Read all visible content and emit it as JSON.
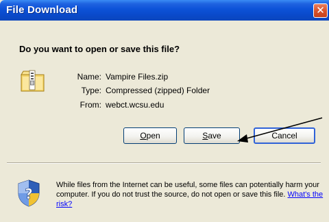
{
  "window": {
    "title": "File Download",
    "close_glyph": "✕",
    "titlebar_color": "#0a49c9",
    "background_color": "#ece9d8"
  },
  "dialog": {
    "question": "Do you want to open or save this file?",
    "file_icon": "zip-folder-icon",
    "fields": [
      {
        "label": "Name:",
        "value": "Vampire Files.zip"
      },
      {
        "label": "Type:",
        "value": "Compressed (zipped) Folder"
      },
      {
        "label": "From:",
        "value": "webct.wcsu.edu"
      }
    ],
    "buttons": {
      "open": {
        "mnemonic": "O",
        "rest": "pen"
      },
      "save": {
        "mnemonic": "S",
        "rest": "ave"
      },
      "cancel": "Cancel"
    },
    "warning_icon": "shield-question-icon",
    "warning_text": "While files from the Internet can be useful, some files can potentially harm your computer. If you do not trust the source, do not open or save this file.",
    "risk_link": "What's the risk?",
    "annotation": "arrow-pointing-to-save-button"
  }
}
